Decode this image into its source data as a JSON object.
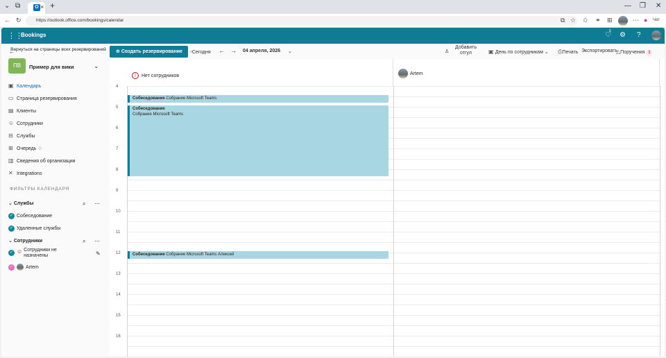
{
  "browser": {
    "url": "https://outlook.office.com/bookings/calendar",
    "chat_label": "Чат"
  },
  "app": {
    "name": "Bookings"
  },
  "header": {
    "notification_count": "5"
  },
  "sidebar": {
    "back_label": "Вернуться на страницы всех резервирований",
    "business_initials": "ПВ",
    "business_name": "Пример для вики",
    "nav": [
      {
        "label": "Календарь",
        "icon": "calendar-icon"
      },
      {
        "label": "Страница резервирования",
        "icon": "booking-page-icon"
      },
      {
        "label": "Клиенты",
        "icon": "customers-icon"
      },
      {
        "label": "Сотрудники",
        "icon": "staff-icon"
      },
      {
        "label": "Службы",
        "icon": "services-icon"
      },
      {
        "label": "Очередь",
        "icon": "queue-icon"
      },
      {
        "label": "Сведения об организации",
        "icon": "business-info-icon"
      },
      {
        "label": "Integrations",
        "icon": "integrations-icon"
      }
    ],
    "filters_title": "ФИЛЬТРЫ КАЛЕНДАРЯ",
    "services_group": "Службы",
    "services": [
      "Собеседование",
      "Удаленные службы"
    ],
    "staff_group": "Сотрудники",
    "staff": [
      "Сотрудники не назначены",
      "Artem"
    ]
  },
  "toolbar": {
    "create_label": "Создать резервирование",
    "today_label": "Сегодня",
    "date_label": "04 апреля, 2026",
    "add_timeoff_label": "Добавить отгул",
    "view_label": "День по сотрудникам",
    "print_label": "Печать",
    "export_label": "Экспортировать",
    "assignments_label": "Поручения",
    "assignments_count": "3"
  },
  "columns": {
    "unassigned": "Нет сотрудников",
    "staff": "Artem"
  },
  "hours": [
    "5",
    "6",
    "7",
    "8",
    "9",
    "10",
    "11",
    "12",
    "13",
    "14",
    "15",
    "16"
  ],
  "events": [
    {
      "service": "Собеседование",
      "detail": "Собрание Microsoft Teams"
    },
    {
      "service": "Собеседование",
      "detail": "Собрание Microsoft Teams"
    },
    {
      "service": "Собеседование",
      "detail": "Собрание Microsoft Teams Алексей"
    }
  ]
}
